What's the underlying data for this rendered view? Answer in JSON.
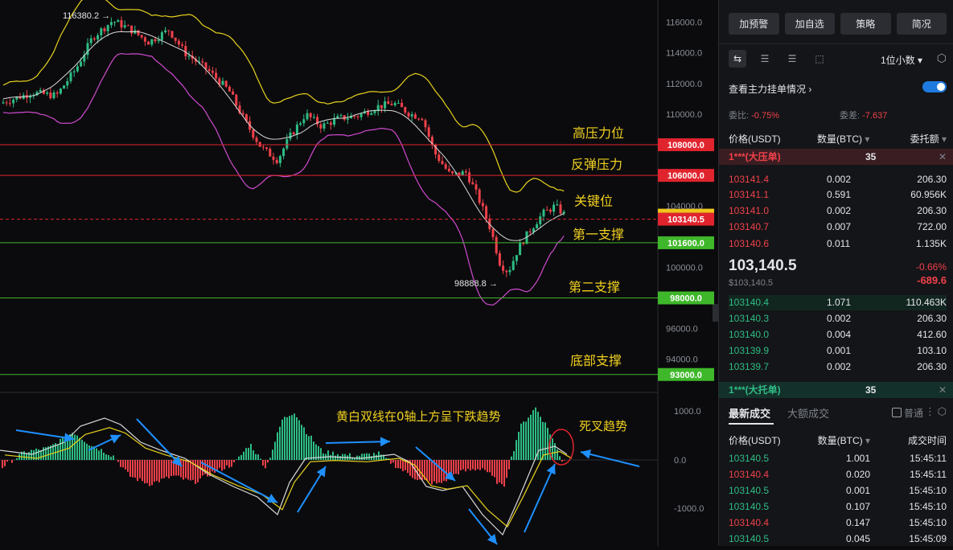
{
  "chart": {
    "price_axis": [
      "116000.0",
      "114000.0",
      "112000.0",
      "110000.0",
      "104000.0",
      "100000.0",
      "96000.0",
      "94000.0"
    ],
    "macd_axis": [
      "1000.0",
      "0.0",
      "-1000.0"
    ],
    "levels": [
      {
        "label": "高压力位",
        "price": "108000.0",
        "color": "#e0242e"
      },
      {
        "label": "反弹压力",
        "price": "106000.0",
        "color": "#e0242e"
      },
      {
        "label": "关键位",
        "price": "103140.5",
        "color": "#e0242e"
      },
      {
        "label": "第一支撑",
        "price": "101600.0",
        "color": "#3fb72a"
      },
      {
        "label": "第二支撑",
        "price": "98000.0",
        "color": "#3fb72a"
      },
      {
        "label": "底部支撑",
        "price": "93000.0",
        "color": "#3fb72a"
      }
    ],
    "high_annotation": "116380.2",
    "low_annotation": "98888.8",
    "macd_note": "黄白双线在0轴上方呈下跌趋势",
    "dead_cross_note": "死叉趋势"
  },
  "panel": {
    "buttons": [
      "加预警",
      "加自选",
      "策略",
      "简况"
    ],
    "decimal_select": "1位小数",
    "main_orders_link": "查看主力挂单情况",
    "ratio_label": "委比:",
    "ratio_value": "-0.75%",
    "diff_label": "委差:",
    "diff_value": "-7.637",
    "ob_headers": {
      "price": "价格(USDT)",
      "qty": "数量(BTC)",
      "total": "委托额"
    },
    "big_sell": {
      "label": "1***(大压单)",
      "qty": "35"
    },
    "asks": [
      {
        "price": "103141.4",
        "qty": "0.002",
        "total": "206.30"
      },
      {
        "price": "103141.1",
        "qty": "0.591",
        "total": "60.956K"
      },
      {
        "price": "103141.0",
        "qty": "0.002",
        "total": "206.30"
      },
      {
        "price": "103140.7",
        "qty": "0.007",
        "total": "722.00"
      },
      {
        "price": "103140.6",
        "qty": "0.011",
        "total": "1.135K"
      }
    ],
    "last_price": "103,140.5",
    "last_price_usd": "$103,140.5",
    "change_pct": "-0.66%",
    "change_abs": "-689.6",
    "bids": [
      {
        "price": "103140.4",
        "qty": "1.071",
        "total": "110.463K"
      },
      {
        "price": "103140.3",
        "qty": "0.002",
        "total": "206.30"
      },
      {
        "price": "103140.0",
        "qty": "0.004",
        "total": "412.60"
      },
      {
        "price": "103139.9",
        "qty": "0.001",
        "total": "103.10"
      },
      {
        "price": "103139.7",
        "qty": "0.002",
        "total": "206.30"
      }
    ],
    "big_buy": {
      "label": "1***(大托单)",
      "qty": "35"
    },
    "tabs": {
      "latest": "最新成交",
      "big": "大额成交",
      "normal": "普通"
    },
    "trade_headers": {
      "price": "价格(USDT)",
      "qty": "数量(BTC)",
      "time": "成交时间"
    },
    "trades": [
      {
        "price": "103140.5",
        "qty": "1.001",
        "time": "15:45:11",
        "side": "buy"
      },
      {
        "price": "103140.4",
        "qty": "0.020",
        "time": "15:45:11",
        "side": "sell"
      },
      {
        "price": "103140.5",
        "qty": "0.001",
        "time": "15:45:10",
        "side": "buy"
      },
      {
        "price": "103140.5",
        "qty": "0.107",
        "time": "15:45:10",
        "side": "buy"
      },
      {
        "price": "103140.4",
        "qty": "0.147",
        "time": "15:45:10",
        "side": "sell"
      },
      {
        "price": "103140.5",
        "qty": "0.045",
        "time": "15:45:09",
        "side": "buy"
      }
    ]
  }
}
